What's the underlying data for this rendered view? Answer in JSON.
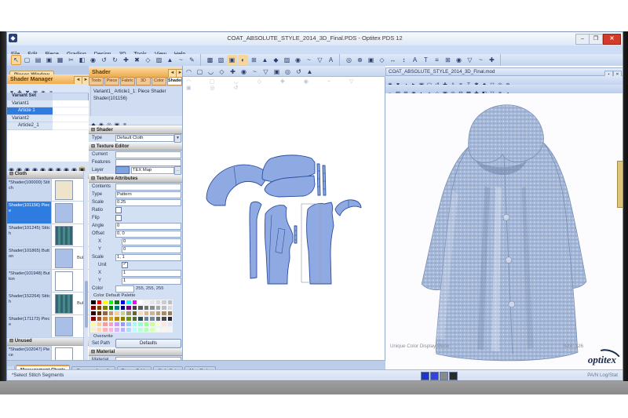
{
  "window": {
    "title": "COAT_ABSOLUTE_STYLE_2014_3D_Final.PDS - Optitex PDS 12",
    "controls": {
      "minimize": "–",
      "maximize": "❐",
      "close": "✕"
    }
  },
  "menu": {
    "items": [
      "File",
      "Edit",
      "Piece",
      "Grading",
      "Design",
      "3D",
      "Tools",
      "View",
      "Help"
    ]
  },
  "toolbar": {
    "groups": [
      {
        "name": "file-edit",
        "icons": [
          {
            "n": "pointer-tool",
            "g": "↖",
            "hl": true
          },
          {
            "n": "new-file",
            "g": "▢"
          },
          {
            "n": "open-file",
            "g": "▤"
          },
          {
            "n": "save-file",
            "g": "▣"
          },
          {
            "n": "print",
            "g": "▦"
          },
          {
            "n": "cut",
            "g": "✂"
          },
          {
            "n": "copy",
            "g": "◧"
          },
          {
            "n": "paste",
            "g": "◉"
          },
          {
            "n": "undo",
            "g": "↺"
          },
          {
            "n": "redo",
            "g": "↻"
          },
          {
            "n": "zoom-in",
            "g": "✚"
          },
          {
            "n": "delete",
            "g": "✖"
          },
          {
            "n": "measure",
            "g": "◇"
          },
          {
            "n": "grid",
            "g": "▨"
          },
          {
            "n": "point",
            "g": "▲"
          },
          {
            "n": "curve",
            "g": "~"
          },
          {
            "n": "draw",
            "g": "✎"
          }
        ]
      },
      {
        "name": "piece-tools",
        "icons": [
          {
            "n": "piece-table",
            "g": "▩"
          },
          {
            "n": "grade-view",
            "g": "▧"
          },
          {
            "n": "seam",
            "g": "▣",
            "c": "#f6d79a"
          },
          {
            "n": "notch",
            "g": "◐",
            "c": "#f6d79a"
          },
          {
            "n": "rotate-piece",
            "g": "⊞"
          },
          {
            "n": "flip-piece",
            "g": "▲"
          },
          {
            "n": "dart",
            "g": "◆"
          },
          {
            "n": "pleat",
            "g": "▨"
          },
          {
            "n": "buttons",
            "g": "◉"
          },
          {
            "n": "stitch",
            "g": "~"
          },
          {
            "n": "shrink",
            "g": "▽"
          },
          {
            "n": "text-tool",
            "g": "A"
          }
        ]
      },
      {
        "name": "view-3d",
        "icons": [
          {
            "n": "3d-view",
            "g": "◎"
          },
          {
            "n": "add-point",
            "g": "⊕"
          },
          {
            "n": "walk",
            "g": "▣"
          },
          {
            "n": "ruler",
            "g": "◇"
          },
          {
            "n": "move-h",
            "g": "↔"
          },
          {
            "n": "move-v",
            "g": "↕"
          },
          {
            "n": "annotate",
            "g": "A"
          },
          {
            "n": "text",
            "g": "T"
          },
          {
            "n": "layers",
            "g": "≡"
          },
          {
            "n": "table",
            "g": "⊞"
          },
          {
            "n": "target",
            "g": "◉"
          },
          {
            "n": "down",
            "g": "▽"
          },
          {
            "n": "wave",
            "g": "~"
          },
          {
            "n": "plus",
            "g": "✚"
          }
        ]
      }
    ]
  },
  "left_panel": {
    "tab": "Pieces Window",
    "header": "Shader Manager",
    "mini_icons": [
      {
        "n": "filter",
        "g": "▼"
      },
      {
        "n": "add-variant",
        "g": "✚"
      },
      {
        "n": "remove-variant",
        "g": "✖"
      },
      {
        "n": "save-set",
        "g": "▣"
      },
      {
        "n": "refresh",
        "g": "◉"
      },
      {
        "n": "list",
        "g": "≡"
      }
    ],
    "circle_icons": [
      {
        "n": "shade-all",
        "g": "◉"
      },
      {
        "n": "shade-piece",
        "g": "◉"
      },
      {
        "n": "shade-stitch",
        "g": "◉"
      },
      {
        "n": "shade-button",
        "g": "◉"
      },
      {
        "n": "shade-fold",
        "g": "◉"
      },
      {
        "n": "shade-texture",
        "g": "◉"
      },
      {
        "n": "shade-color",
        "g": "◉"
      },
      {
        "n": "shade-mat",
        "g": "◉"
      },
      {
        "n": "shade-light",
        "g": "◉"
      },
      {
        "n": "new-swatch",
        "g": "▣",
        "c": "#e0c98e"
      }
    ],
    "tree": [
      {
        "label": "Variant Set",
        "kind": "hdr"
      },
      {
        "label": "Variant1",
        "kind": "parent"
      },
      {
        "label": "Article 1",
        "kind": "child",
        "selected": true
      },
      {
        "label": "Variant2",
        "kind": "parent"
      },
      {
        "label": "Article2_1",
        "kind": "child"
      }
    ],
    "groups": [
      {
        "name": "Cloth",
        "items": [
          {
            "label": "*Shader(100000) Stitch",
            "swatch": "#ede4c9"
          },
          {
            "label": "Shader(101156) Piece",
            "swatch": "#a9bfe8",
            "selected": true
          },
          {
            "label": "Shader(101245) Stitch",
            "swatch": "teal"
          },
          {
            "label": "Shader(101865) Button",
            "swatch": "#a9bfe8",
            "tag": "Bulk"
          },
          {
            "label": "*Shader(101948) Button",
            "swatch": "#ffffff"
          },
          {
            "label": "Shader(152264) Stitch",
            "swatch": "teal",
            "tag": "Bulk"
          },
          {
            "label": "Shader(171173) Piece",
            "swatch": "#a9bfe8"
          }
        ]
      },
      {
        "name": "Unused",
        "items": [
          {
            "label": "*Shader(102047) Piece",
            "swatch": "#ffffff"
          }
        ]
      }
    ]
  },
  "shader_panel": {
    "title": "Shader",
    "tabs": [
      "Tools",
      "Piece",
      "Fabric",
      "3D",
      "Color",
      "Shader"
    ],
    "active_tab": 5,
    "info_line1": "Variant1_ Article1_1: Piece Shader",
    "info_line2": "Shader(101156)",
    "icons": [
      {
        "n": "pick-shader",
        "g": "◆"
      },
      {
        "n": "apply-shader",
        "g": "◉"
      },
      {
        "n": "reset-shader",
        "g": "◎"
      },
      {
        "n": "copy-shader",
        "g": "▣"
      },
      {
        "n": "shader-list",
        "g": "≡"
      }
    ],
    "rows": [
      {
        "k": "section",
        "label": "Shader"
      },
      {
        "k": "field",
        "label": "Type",
        "value": "Default Cloth",
        "dd": true
      },
      {
        "k": "section",
        "label": "Texture Editor"
      },
      {
        "k": "field",
        "label": "Current",
        "value": ""
      },
      {
        "k": "field",
        "label": "Features",
        "value": ""
      },
      {
        "k": "layer",
        "label": "Layer",
        "value": "TEX Map"
      },
      {
        "k": "section",
        "label": "Texture Attributes"
      },
      {
        "k": "field",
        "label": "Contents",
        "value": ""
      },
      {
        "k": "field",
        "label": "Type",
        "value": "Pattern"
      },
      {
        "k": "field",
        "label": "Scale",
        "value": "0.25"
      },
      {
        "k": "check",
        "label": "Ratio",
        "checked": false
      },
      {
        "k": "check",
        "label": "Flip",
        "checked": false
      },
      {
        "k": "field",
        "label": "Angle",
        "value": "0"
      },
      {
        "k": "field",
        "label": "Offset",
        "value": "0, 0"
      },
      {
        "k": "field",
        "label": "X",
        "value": "0",
        "ind": true
      },
      {
        "k": "field",
        "label": "Y",
        "value": "0",
        "ind": true
      },
      {
        "k": "field",
        "label": "Scale",
        "value": "1, 1"
      },
      {
        "k": "check",
        "label": "Unit",
        "checked": true,
        "ind": true
      },
      {
        "k": "field",
        "label": "X",
        "value": "1",
        "ind": true
      },
      {
        "k": "field",
        "label": "Y",
        "value": "1",
        "ind": true
      },
      {
        "k": "color",
        "label": "Color",
        "value": "255, 255, 255",
        "swatch": "#ffffff"
      },
      {
        "k": "caption",
        "label": "Color Default Palette"
      },
      {
        "k": "palette"
      },
      {
        "k": "caption",
        "label": "Overwrite"
      },
      {
        "k": "button",
        "label": "Set Path",
        "value": "Defaults"
      },
      {
        "k": "section",
        "label": "Material"
      },
      {
        "k": "field",
        "label": "Material",
        "value": ""
      }
    ],
    "palette": [
      [
        "#000000",
        "#ff0000",
        "#ffff00",
        "#00ff00",
        "#008000",
        "#0000ff",
        "#00ffff",
        "#ff00ff",
        "#ffffff",
        "#f2f2f2",
        "#e6e6e6",
        "#d9d9d9",
        "#cccccc",
        "#bfbfbf"
      ],
      [
        "#7f0000",
        "#7f3f00",
        "#7f7f00",
        "#007f00",
        "#007f7f",
        "#00007f",
        "#7f007f",
        "#3f3f3f",
        "#595959",
        "#737373",
        "#8c8c8c",
        "#a6a6a6",
        "#bfbfbf",
        "#d9d9d9"
      ],
      [
        "#330000",
        "#663300",
        "#996633",
        "#cc9966",
        "#ffcc99",
        "#cccc99",
        "#999966",
        "#666633",
        "#f5deb3",
        "#deb887",
        "#d2b48c",
        "#c0a070",
        "#b08d57",
        "#9a7b4f"
      ],
      [
        "#800000",
        "#a0522d",
        "#cd853f",
        "#daa520",
        "#b8860b",
        "#808000",
        "#6b8e23",
        "#556b2f",
        "#2f4f4f",
        "#708090",
        "#778899",
        "#696969",
        "#484848",
        "#282828"
      ],
      [
        "#ffff99",
        "#ffcc99",
        "#ff9999",
        "#ff99cc",
        "#cc99ff",
        "#9999ff",
        "#99ccff",
        "#99ffff",
        "#99ffcc",
        "#99ff99",
        "#ccff99",
        "#ffffcc",
        "#ffe4e1",
        "#e6e6fa"
      ],
      [
        "#fff0c1",
        "#ffd9b3",
        "#ffb3b3",
        "#ffb3d9",
        "#d9b3ff",
        "#b3b3ff",
        "#b3d9ff",
        "#b3ffff",
        "#b3ffd9",
        "#b3ffb3",
        "#d9ffb3",
        "#f0fff0",
        "#fdf5e6",
        "#f5f5f5"
      ]
    ]
  },
  "canvas": {
    "strip_icons": [
      {
        "n": "pan-canvas",
        "g": "◠"
      },
      {
        "n": "select-box",
        "g": "▢"
      },
      {
        "n": "arc-tool",
        "g": "◡"
      },
      {
        "n": "diamond-point",
        "g": "◇"
      },
      {
        "n": "add-notch",
        "g": "✚"
      },
      {
        "n": "circle-tool",
        "g": "◉"
      },
      {
        "n": "trace",
        "g": "~"
      },
      {
        "n": "flip-v",
        "g": "▽"
      },
      {
        "n": "fill-piece",
        "g": "▣"
      },
      {
        "n": "target-point",
        "g": "◎"
      },
      {
        "n": "rotate-view",
        "g": "↺"
      },
      {
        "n": "grain-line",
        "g": "▲"
      }
    ]
  },
  "right_panel": {
    "title": "COAT_ABSOLUTE_STYLE_2014_3D_Final.mod",
    "controls": {
      "dock": "▪",
      "close": "✕"
    },
    "toolbar1": [
      {
        "n": "3d-open",
        "g": "◉"
      },
      {
        "n": "3d-dropdown",
        "g": "▼"
      },
      {
        "n": "3d-contrast",
        "g": "◑"
      },
      {
        "n": "3d-play",
        "g": "►"
      },
      {
        "n": "3d-record",
        "g": "▣"
      },
      {
        "n": "3d-frame",
        "g": "▢"
      },
      {
        "n": "3d-reset",
        "g": "↺"
      },
      {
        "n": "3d-add",
        "g": "✚"
      },
      {
        "n": "3d-annotate",
        "g": "A"
      },
      {
        "n": "3d-layers",
        "g": "≡"
      },
      {
        "n": "3d-text",
        "g": "T"
      },
      {
        "n": "3d-burst",
        "g": "✱"
      },
      {
        "n": "3d-gem",
        "g": "◆"
      },
      {
        "n": "3d-down",
        "g": "▽"
      },
      {
        "n": "3d-sphere",
        "g": "◎"
      },
      {
        "n": "3d-plus",
        "g": "⊕"
      }
    ],
    "toolbar2": [
      {
        "n": "sim-wave",
        "g": "~"
      },
      {
        "n": "sim-cloth",
        "g": "▨"
      },
      {
        "n": "sim-grid",
        "g": "⊞"
      },
      {
        "n": "sim-sphere",
        "g": "◉"
      },
      {
        "n": "sim-shade",
        "g": "◐"
      },
      {
        "n": "sim-up",
        "g": "▲"
      },
      {
        "n": "sim-gem",
        "g": "◇"
      },
      {
        "n": "sim-save",
        "g": "▣"
      },
      {
        "n": "sim-orbit",
        "g": "◎"
      },
      {
        "n": "sim-minus",
        "g": "⊟"
      },
      {
        "n": "sim-texture",
        "g": "▩"
      },
      {
        "n": "sim-add",
        "g": "✚"
      },
      {
        "n": "sim-half",
        "g": "◧"
      },
      {
        "n": "sim-down",
        "g": "▽"
      },
      {
        "n": "sim-list",
        "g": "≡"
      },
      {
        "n": "sim-dot",
        "g": "▪"
      }
    ],
    "display_mode": "Unique Color Display Mode",
    "size_label": "Size: 126",
    "logo": "optitex"
  },
  "bottom": {
    "tabs": [
      "Measurement Charts",
      "Compare Length",
      "Pieces Table",
      "Style Sets",
      "Map Order"
    ],
    "active_tab": 0,
    "status": "*Select Stitch Segments",
    "status_right": "PA/N  Log/Stat",
    "status_icons": [
      "#2233cc",
      "#3344dd",
      "#8a8a8a",
      "#2a2a2a"
    ]
  },
  "colors": {
    "accent_orange": "#f0a63e",
    "selection_blue": "#2f7ce0",
    "piece_fill": "#8fa9e2",
    "piece_outline": "#2a4fa0",
    "teal_swatch": "#3a7b7e"
  }
}
